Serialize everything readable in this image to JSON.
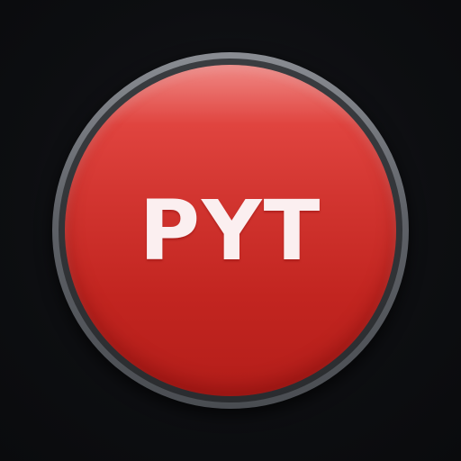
{
  "app_icon": {
    "button_label": "PYT",
    "colors": {
      "background": "#0d0e11",
      "bezel": "#6a6d72",
      "button_red": "#d23530",
      "label": "#fbeff0"
    }
  }
}
